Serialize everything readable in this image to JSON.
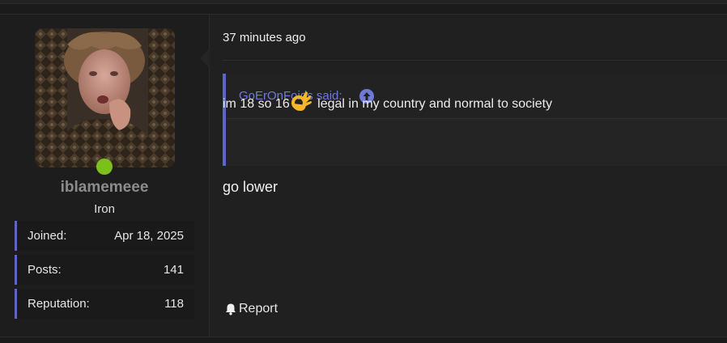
{
  "user": {
    "username": "iblamemeee",
    "rank": "Iron",
    "avatar_icon": "user-avatar-photo",
    "online_color": "#7cc11b",
    "stats": [
      {
        "label": "Joined:",
        "value": "Apr 18, 2025"
      },
      {
        "label": "Posts:",
        "value": "141"
      },
      {
        "label": "Reputation:",
        "value": "118"
      }
    ]
  },
  "post": {
    "timestamp": "37 minutes ago",
    "quote": {
      "author_text": "GoErOnFoids said:",
      "jump_icon": "arrow-up-circle-icon",
      "text_before": "im 18 so 16",
      "emoji": "ok-hand-emoji",
      "text_after": " legal in my country and normal to society"
    },
    "message": "go lower",
    "report_label": "Report",
    "report_icon": "bell-icon"
  },
  "colors": {
    "accent": "#5c66c8",
    "link": "#6f7ad8",
    "background": "#1b1b1b",
    "panel": "#202020"
  }
}
